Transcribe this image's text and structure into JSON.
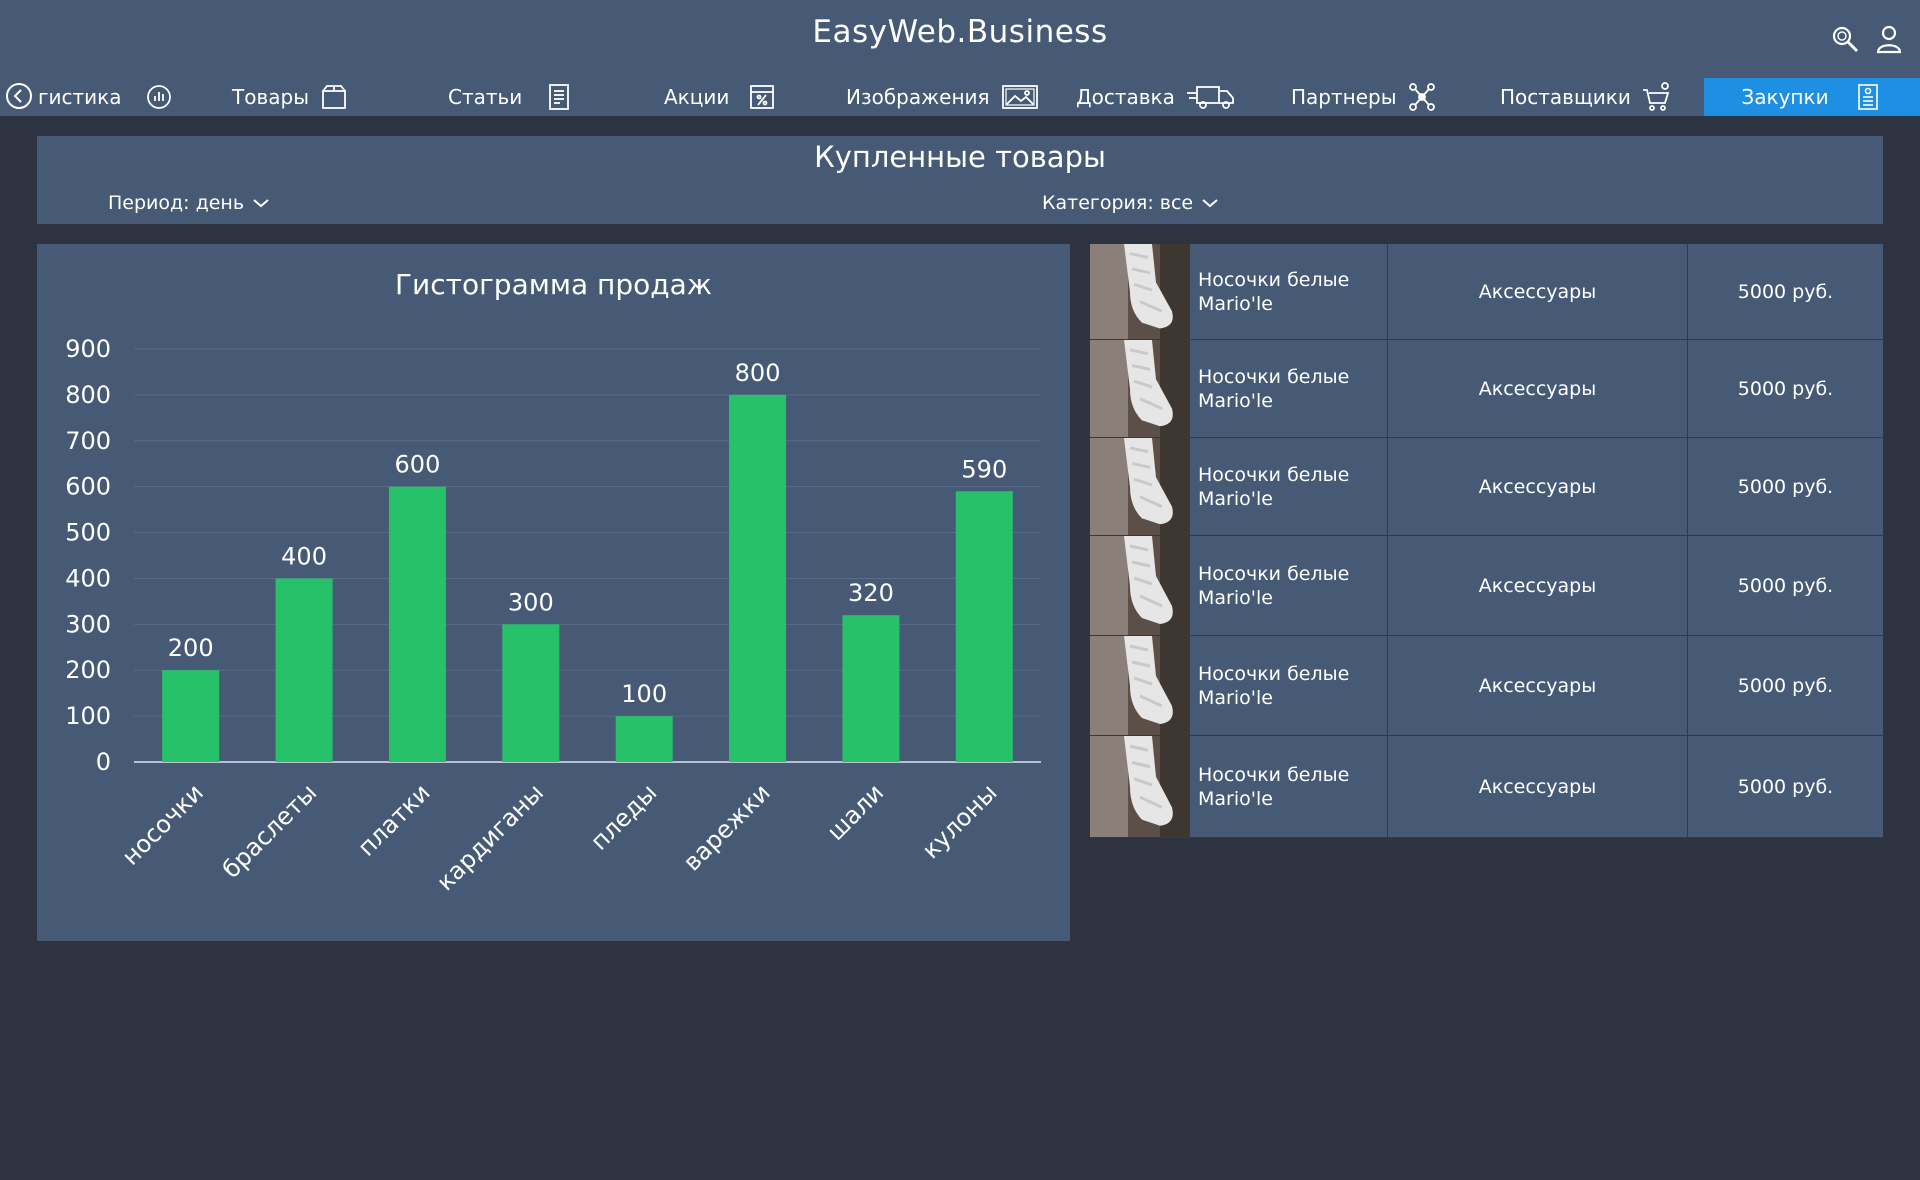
{
  "app": {
    "title": "EasyWeb.Business"
  },
  "nav": {
    "items": [
      {
        "label": "гистика",
        "icon": "stats-icon"
      },
      {
        "label": "Товары",
        "icon": "box-icon"
      },
      {
        "label": "Статьи",
        "icon": "document-icon"
      },
      {
        "label": "Акции",
        "icon": "discount-icon"
      },
      {
        "label": "Изображения",
        "icon": "image-icon"
      },
      {
        "label": "Доставка",
        "icon": "truck-icon"
      },
      {
        "label": "Партнеры",
        "icon": "partners-icon"
      },
      {
        "label": "Поставщики",
        "icon": "cart-icon"
      },
      {
        "label": "Закупки",
        "icon": "purchase-icon",
        "active": true
      }
    ]
  },
  "page": {
    "title": "Купленные товары",
    "filters": {
      "period": "Период: день",
      "category": "Категория: все"
    }
  },
  "chart_data": {
    "type": "bar",
    "title": "Гистограмма продаж",
    "categories": [
      "носочки",
      "браслеты",
      "платки",
      "кардиганы",
      "пледы",
      "варежки",
      "шали",
      "кулоны"
    ],
    "values": [
      200,
      400,
      600,
      300,
      100,
      800,
      320,
      590
    ],
    "ylim": [
      0,
      900
    ],
    "yticks": [
      0,
      100,
      200,
      300,
      400,
      500,
      600,
      700,
      800,
      900
    ],
    "grid": true,
    "bar_color": "#27c16a"
  },
  "table": {
    "rows": [
      {
        "name": "Носочки белые Mario'le",
        "category": "Аксессуары",
        "price": "5000 руб."
      },
      {
        "name": "Носочки белые Mario'le",
        "category": "Аксессуары",
        "price": "5000 руб."
      },
      {
        "name": "Носочки белые Mario'le",
        "category": "Аксессуары",
        "price": "5000 руб."
      },
      {
        "name": "Носочки белые Mario'le",
        "category": "Аксессуары",
        "price": "5000 руб."
      },
      {
        "name": "Носочки белые Mario'le",
        "category": "Аксессуары",
        "price": "5000 руб."
      },
      {
        "name": "Носочки белые Mario'le",
        "category": "Аксессуары",
        "price": "5000 руб."
      }
    ]
  },
  "colors": {
    "background": "#2d3340",
    "panel": "#465a75",
    "accent": "#1e8fe3"
  }
}
